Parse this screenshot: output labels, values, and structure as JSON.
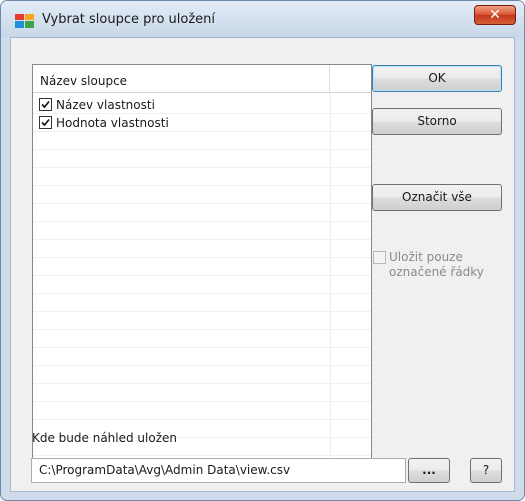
{
  "window": {
    "title": "Vybrat sloupce pro uložení",
    "close_symbol": "✕",
    "icon": "avg-app-icon"
  },
  "list": {
    "column_header": "Název sloupce",
    "items": [
      {
        "label": "Název vlastnosti",
        "checked": true
      },
      {
        "label": "Hodnota vlastnosti",
        "checked": true
      }
    ]
  },
  "buttons": {
    "ok": "OK",
    "cancel": "Storno",
    "select_all": "Označit vše",
    "browse": "...",
    "help": "?"
  },
  "options": {
    "save_marked_only": {
      "label": "Uložit pouze označené řádky",
      "checked": false,
      "enabled": false
    }
  },
  "save": {
    "label": "Kde bude náhled uložen",
    "path": "C:\\ProgramData\\Avg\\Admin Data\\view.csv"
  },
  "colors": {
    "frame": "#cfdceb",
    "client": "#f0f0f0",
    "close_button": "#d8542f",
    "default_button_border": "#3c7fb1"
  }
}
